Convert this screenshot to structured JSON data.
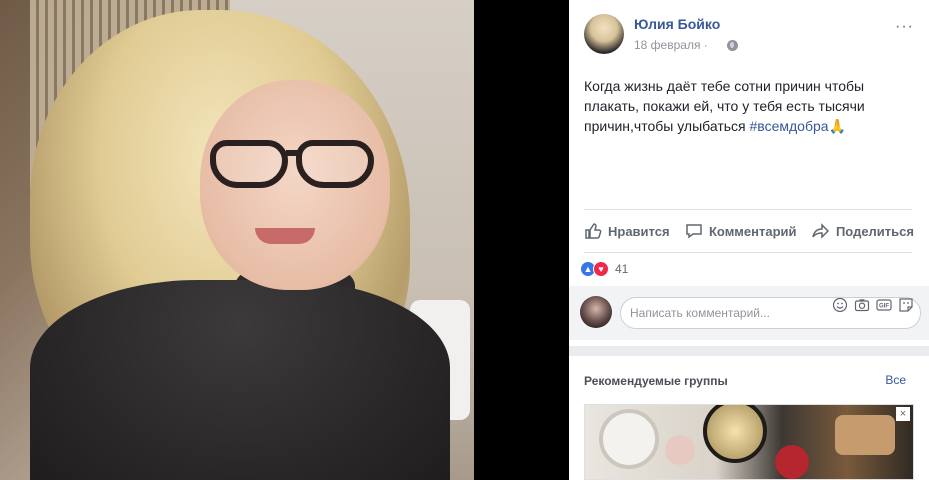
{
  "post": {
    "author": "Юлия Бойко",
    "date": "18 февраля",
    "separator": "·",
    "more": "···",
    "text": "Когда жизнь даёт тебе сотни причин чтобы плакать, покажи ей, что у тебя есть тысячи причин,чтобы улыбаться ",
    "hashtag": "#всемдобра",
    "emoji": "🙏"
  },
  "actions": {
    "like": "Нравится",
    "comment": "Комментарий",
    "share": "Поделиться"
  },
  "reactions": {
    "count": "41"
  },
  "comment_box": {
    "placeholder": "Написать комментарий..."
  },
  "groups": {
    "title": "Рекомендуемые группы",
    "see_all": "Все",
    "close": "×"
  },
  "colors": {
    "link": "#385898",
    "text": "#1d2129",
    "muted": "#90949c"
  }
}
